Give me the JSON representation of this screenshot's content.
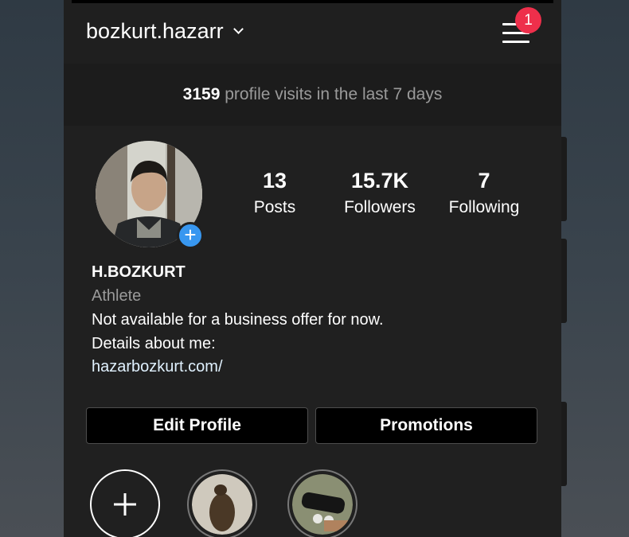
{
  "header": {
    "username": "bozkurt.hazarr",
    "menu_icon": "hamburger-menu-icon",
    "notification_count": "1"
  },
  "visits": {
    "count": "3159",
    "text": "profile visits in the last 7 days"
  },
  "profile": {
    "stats": [
      {
        "value": "13",
        "label": "Posts"
      },
      {
        "value": "15.7K",
        "label": "Followers"
      },
      {
        "value": "7",
        "label": "Following"
      }
    ],
    "display_name": "H.BOZKURT",
    "category": "Athlete",
    "bio_line1": "Not available for a business offer for now.",
    "bio_line2": "Details about me:",
    "link": "hazarbozkurt.com/"
  },
  "buttons": {
    "edit_profile": "Edit Profile",
    "promotions": "Promotions"
  },
  "highlights": {
    "new_icon": "plus-icon",
    "items": [
      "highlight-1",
      "highlight-2"
    ]
  },
  "colors": {
    "background": "#202020",
    "badge": "#ee2f4b",
    "accent": "#3897f0",
    "link": "#e0f1ff"
  }
}
